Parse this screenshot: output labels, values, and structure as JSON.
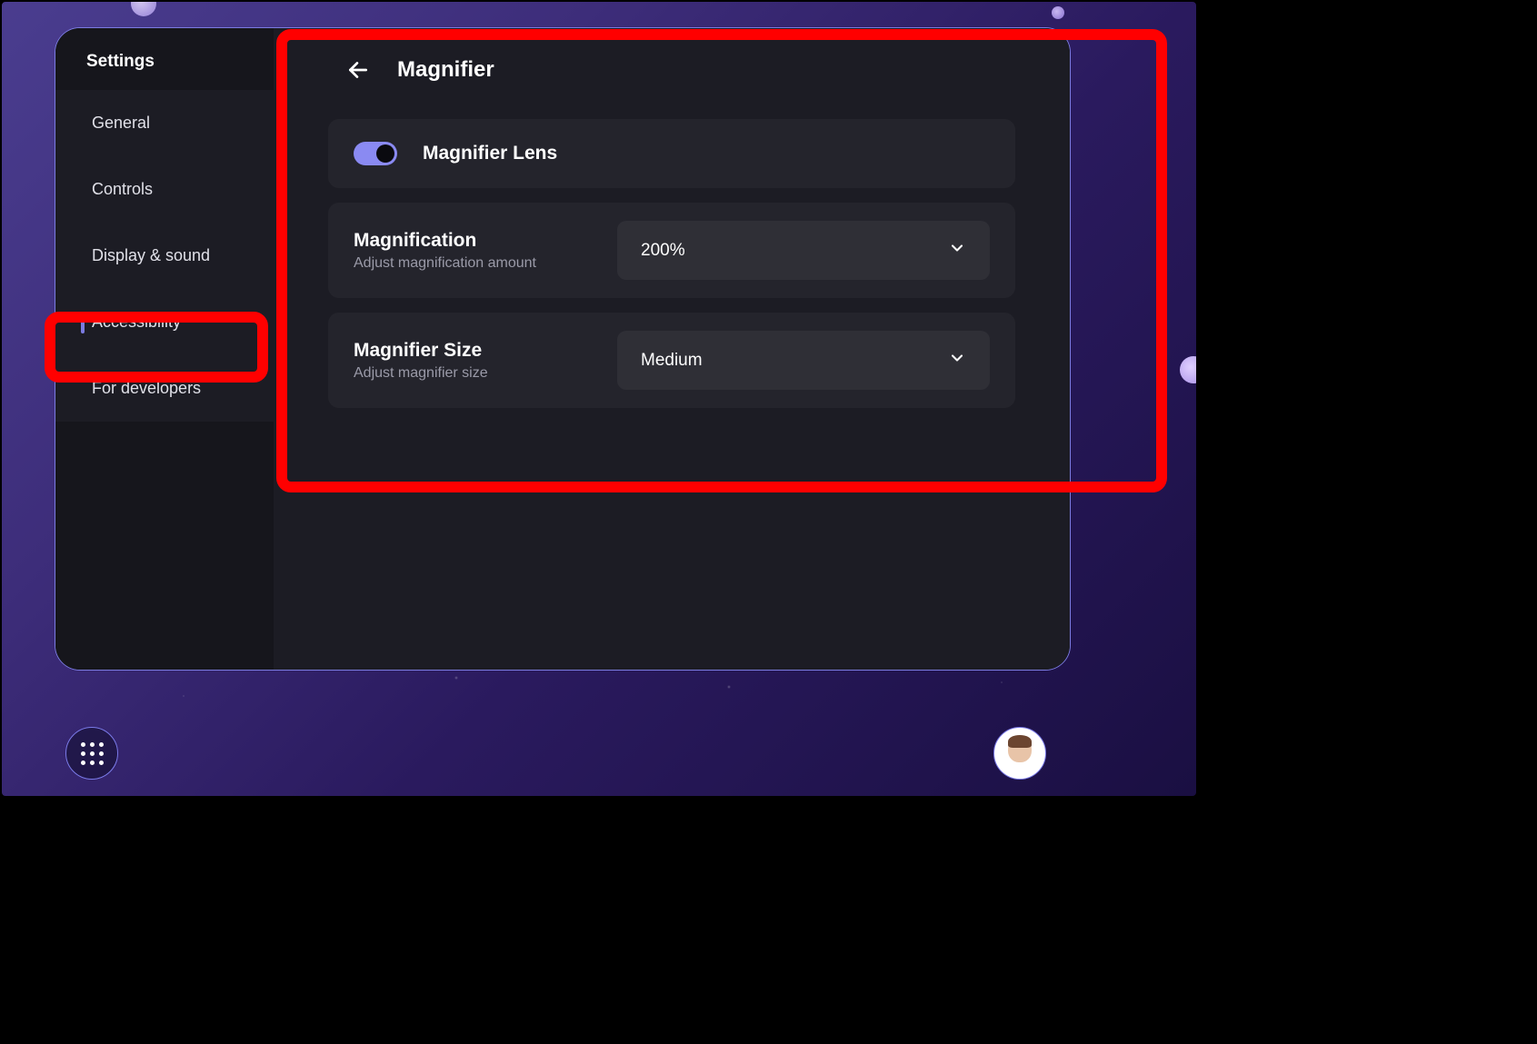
{
  "sidebar": {
    "title": "Settings",
    "items": [
      {
        "label": "General",
        "active": false
      },
      {
        "label": "Controls",
        "active": false
      },
      {
        "label": "Display & sound",
        "active": false
      },
      {
        "label": "Accessibility",
        "active": true
      },
      {
        "label": "For developers",
        "active": false
      }
    ]
  },
  "main": {
    "title": "Magnifier",
    "rows": {
      "toggle": {
        "label": "Magnifier Lens",
        "enabled": true
      },
      "magnification": {
        "title": "Magnification",
        "subtitle": "Adjust magnification amount",
        "value": "200%"
      },
      "magnifierSize": {
        "title": "Magnifier Size",
        "subtitle": "Adjust magnifier size",
        "value": "Medium"
      }
    }
  },
  "colors": {
    "highlight": "#ff0000",
    "accent": "#8a8af2",
    "windowBorder": "#7b7be0"
  }
}
